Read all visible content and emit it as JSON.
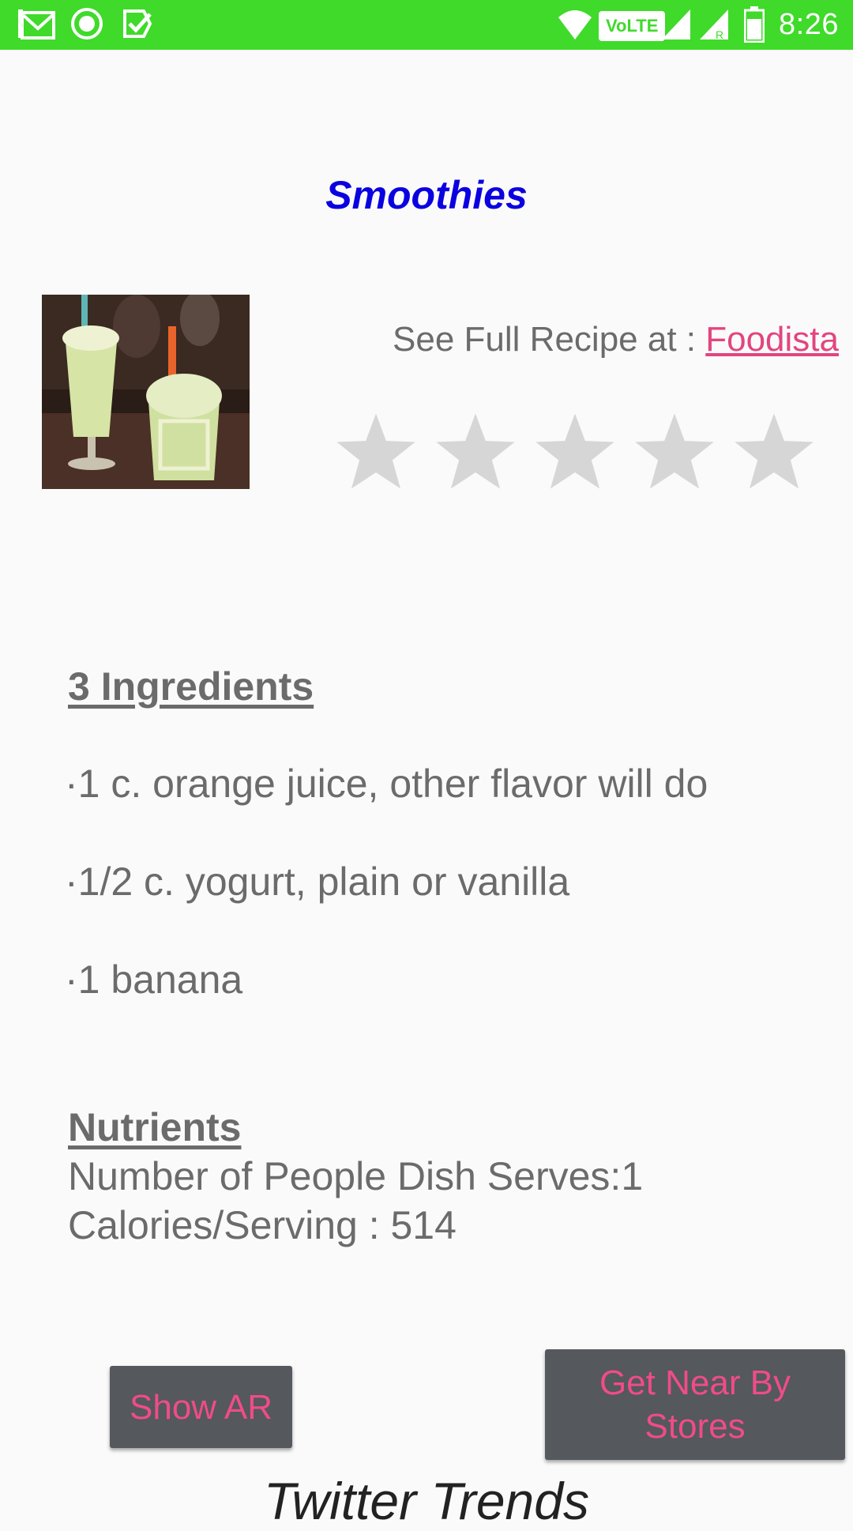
{
  "status_bar": {
    "time": "8:26",
    "left_icons": [
      "gmail-icon",
      "circle-app-icon",
      "task-check-icon"
    ],
    "right_icons": [
      "wifi-icon",
      "volte-icon",
      "signal-icon",
      "signal-roaming-icon",
      "battery-icon"
    ],
    "volte_label": "VoLTE",
    "background_color": "#3fda2a"
  },
  "recipe": {
    "title": "Smoothies",
    "title_color": "#0a00e0",
    "see_full_recipe_label": "See Full Recipe at : ",
    "source_link": "Foodista",
    "link_color": "#e2457f",
    "rating": {
      "value": 0,
      "max": 5
    }
  },
  "ingredients": {
    "heading": "3 Ingredients",
    "items": [
      "·1 c. orange juice, other flavor will do",
      "·1/2 c. yogurt, plain or vanilla",
      "·1 banana"
    ]
  },
  "nutrients": {
    "heading": "Nutrients",
    "serves": "Number of People Dish Serves:1",
    "calories": "Calories/Serving : 514"
  },
  "buttons": {
    "show_ar": "Show AR",
    "near_by_stores": "Get Near By Stores",
    "text_color": "#f04c86",
    "background_color": "#55585d"
  },
  "twitter_trends_label": "Twitter Trends"
}
